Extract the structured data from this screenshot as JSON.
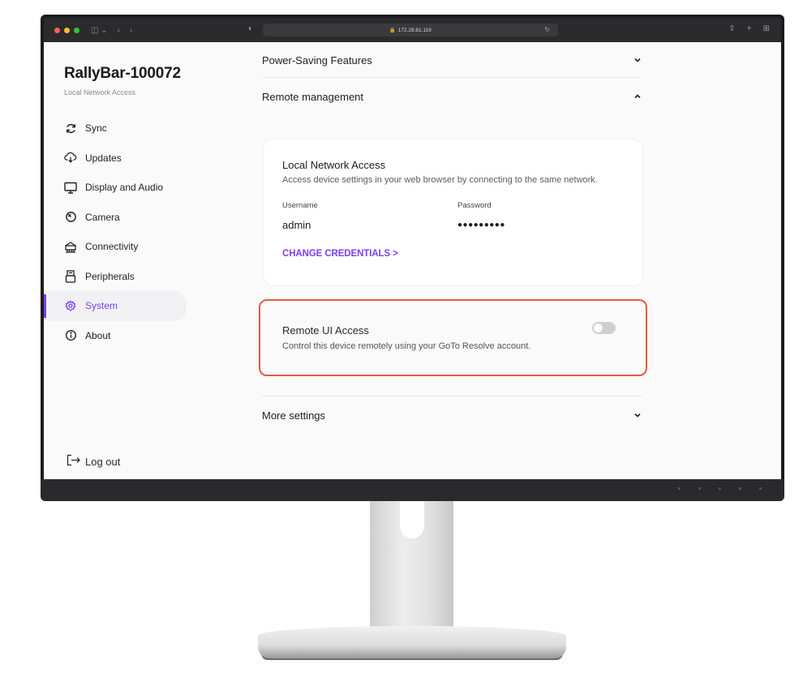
{
  "browser": {
    "url": "172.28.81.119",
    "colors": {
      "close": "#ff5f57",
      "minimize": "#febc2e",
      "zoom": "#28c840"
    }
  },
  "sidebar": {
    "device_name": "RallyBar-100072",
    "subtitle": "Local Network Access",
    "items": [
      {
        "label": "Sync",
        "icon": "sync-icon",
        "active": false
      },
      {
        "label": "Updates",
        "icon": "cloud-download-icon",
        "active": false
      },
      {
        "label": "Display and Audio",
        "icon": "monitor-icon",
        "active": false
      },
      {
        "label": "Camera",
        "icon": "camera-icon",
        "active": false
      },
      {
        "label": "Connectivity",
        "icon": "network-icon",
        "active": false
      },
      {
        "label": "Peripherals",
        "icon": "peripheral-icon",
        "active": false
      },
      {
        "label": "System",
        "icon": "gear-icon",
        "active": true
      },
      {
        "label": "About",
        "icon": "info-icon",
        "active": false
      }
    ],
    "logout_label": "Log out"
  },
  "main": {
    "power_saving": "Power-Saving Features",
    "remote_management": "Remote management",
    "local_access": {
      "title": "Local Network Access",
      "description": "Access device settings in your web browser by connecting to the same network.",
      "username_label": "Username",
      "username_value": "admin",
      "password_label": "Password",
      "password_value": "●●●●●●●●●",
      "change_credentials": "CHANGE CREDENTIALS  >"
    },
    "remote_ui": {
      "title": "Remote UI Access",
      "description": "Control this device remotely using your GoTo Resolve account.",
      "toggle_on": false
    },
    "more_settings": "More settings"
  },
  "theme": {
    "accent": "#7a3ff2",
    "highlight_border": "#e85a3a"
  }
}
